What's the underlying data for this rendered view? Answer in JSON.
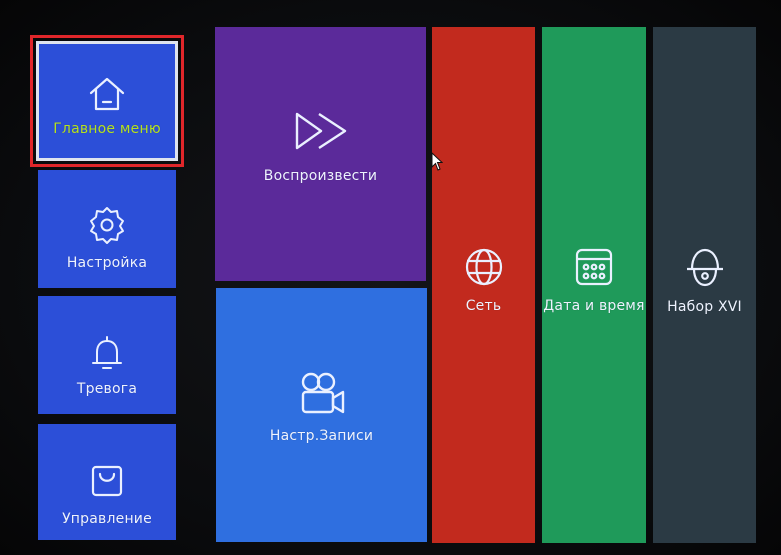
{
  "colors": {
    "blue_tile": "#2c4fd8",
    "blue_tile_light": "#2f6fe0",
    "purple": "#5b2a9a",
    "red": "#c22a1e",
    "green": "#1f9a5a",
    "slate": "#2b3a44",
    "selected_border": "#e0262a",
    "selected_label": "#b6e21f",
    "label": "#eef3ff"
  },
  "left_menu": [
    {
      "label": "Главное меню",
      "icon": "home-icon",
      "selected": true
    },
    {
      "label": "Настройка",
      "icon": "gear-icon"
    },
    {
      "label": "Тревога",
      "icon": "bell-icon"
    },
    {
      "label": "Управление",
      "icon": "bag-icon"
    }
  ],
  "tiles": {
    "playback": {
      "label": "Воспроизвести",
      "icon": "fast-forward-icon"
    },
    "record": {
      "label": "Настр.Записи",
      "icon": "video-camera-icon"
    },
    "network": {
      "label": "Сеть",
      "icon": "globe-icon"
    },
    "datetime": {
      "label": "Дата и время",
      "icon": "calendar-icon"
    },
    "ptz": {
      "label": "Набор XVI",
      "icon": "dome-camera-icon"
    }
  }
}
